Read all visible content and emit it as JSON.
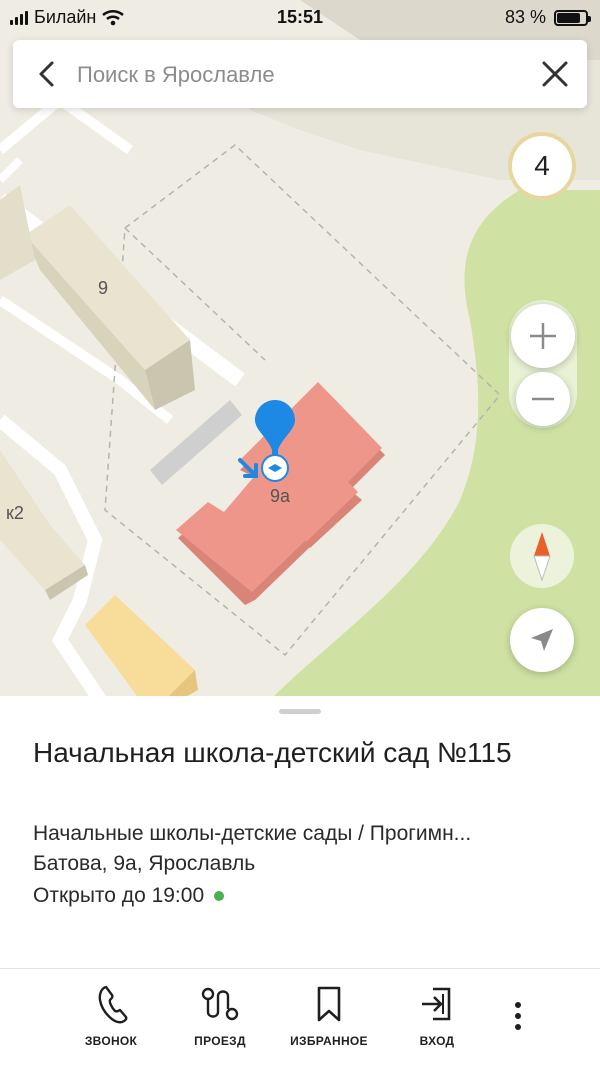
{
  "status_bar": {
    "carrier": "Билайн",
    "time": "15:51",
    "battery": "83 %",
    "battery_level": 0.83
  },
  "search": {
    "placeholder": "Поиск в Ярославле"
  },
  "map": {
    "building_labels": [
      "9",
      "9а",
      "к2"
    ],
    "layer_badge": "4",
    "colors": {
      "background": "#efede3",
      "park": "#cfe2a3",
      "target_building": "#ef968b",
      "pin": "#1e88e5",
      "highlight_building": "#f7dc9a"
    }
  },
  "place": {
    "title": "Начальная школа-детский сад №115",
    "category": "Начальные школы-детские сады / Прогимн...",
    "address": "Батова, 9а, Ярославль",
    "hours": "Открыто до 19:00",
    "open_status_color": "#4caf50"
  },
  "actions": [
    {
      "label": "ЗВОНОК",
      "icon": "phone-icon"
    },
    {
      "label": "ПРОЕЗД",
      "icon": "route-icon"
    },
    {
      "label": "ИЗБРАННОЕ",
      "icon": "bookmark-icon"
    },
    {
      "label": "ВХОД",
      "icon": "entrance-icon"
    }
  ]
}
